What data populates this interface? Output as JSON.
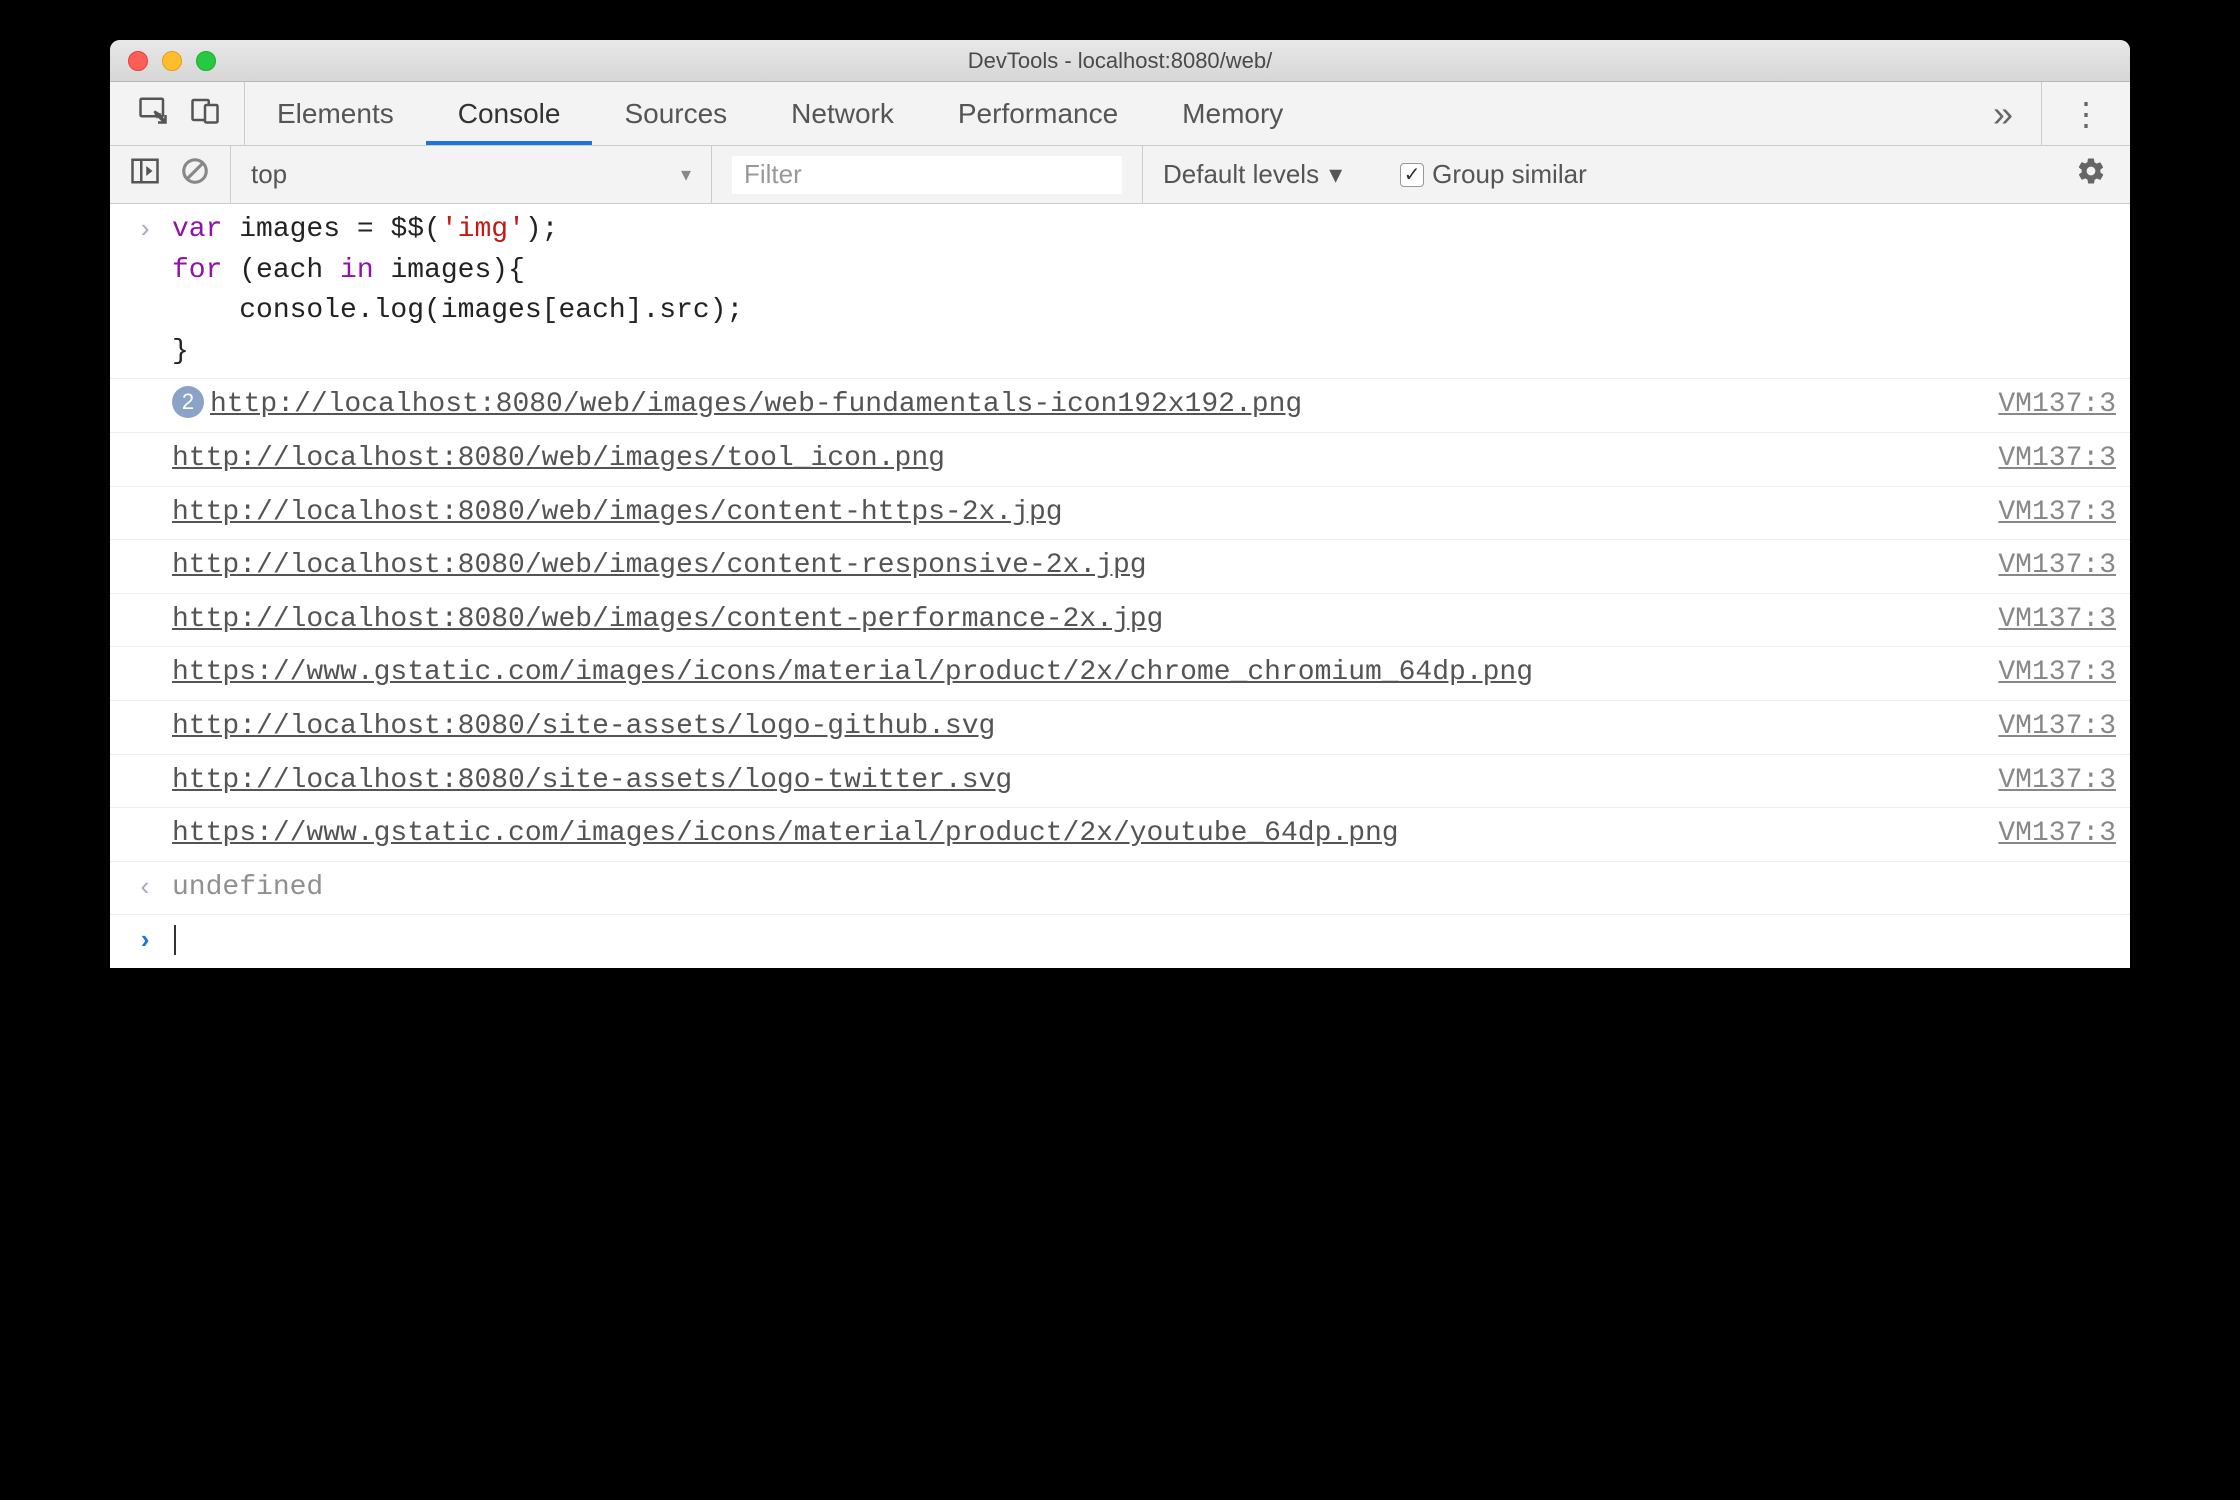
{
  "window": {
    "title": "DevTools - localhost:8080/web/"
  },
  "tabs": {
    "items": [
      "Elements",
      "Console",
      "Sources",
      "Network",
      "Performance",
      "Memory"
    ],
    "active_index": 1
  },
  "subbar": {
    "context": "top",
    "filter_placeholder": "Filter",
    "levels_label": "Default levels",
    "group_label": "Group similar"
  },
  "code": {
    "line1_a": "var",
    "line1_b": " images = $$(",
    "line1_c": "'img'",
    "line1_d": ");",
    "line2_a": "for",
    "line2_b": " (each ",
    "line2_c": "in",
    "line2_d": " images){",
    "line3": "    console.log(images[each].src);",
    "line4": "}"
  },
  "entries": [
    {
      "count": "2",
      "text": "http://localhost:8080/web/images/web-fundamentals-icon192x192.png",
      "src": "VM137:3"
    },
    {
      "count": "",
      "text": "http://localhost:8080/web/images/tool_icon.png",
      "src": "VM137:3"
    },
    {
      "count": "",
      "text": "http://localhost:8080/web/images/content-https-2x.jpg",
      "src": "VM137:3"
    },
    {
      "count": "",
      "text": "http://localhost:8080/web/images/content-responsive-2x.jpg",
      "src": "VM137:3"
    },
    {
      "count": "",
      "text": "http://localhost:8080/web/images/content-performance-2x.jpg",
      "src": "VM137:3"
    },
    {
      "count": "",
      "text": "https://www.gstatic.com/images/icons/material/product/2x/chrome_chromium_64dp.png",
      "src": "VM137:3"
    },
    {
      "count": "",
      "text": "http://localhost:8080/site-assets/logo-github.svg",
      "src": "VM137:3"
    },
    {
      "count": "",
      "text": "http://localhost:8080/site-assets/logo-twitter.svg",
      "src": "VM137:3"
    },
    {
      "count": "",
      "text": "https://www.gstatic.com/images/icons/material/product/2x/youtube_64dp.png",
      "src": "VM137:3"
    }
  ],
  "return_value": "undefined",
  "glyphs": {
    "input_prompt": "›",
    "return_prompt": "‹",
    "chevrons": "»",
    "vdots": "⋮",
    "triangle": "▾",
    "check": "✓"
  }
}
